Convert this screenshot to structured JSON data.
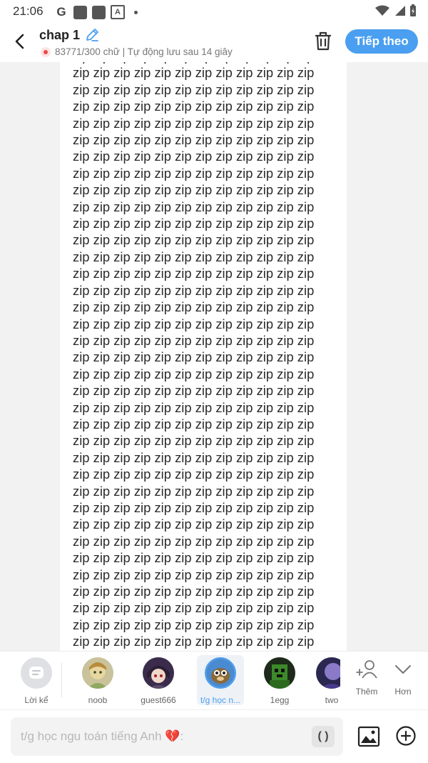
{
  "status_bar": {
    "time": "21:06",
    "google_letter": "G",
    "a_letter": "A"
  },
  "header": {
    "title": "chap 1",
    "subtitle": "83771/300 chữ | Tự động lưu sau 14 giây",
    "next_button": "Tiếp theo"
  },
  "editor": {
    "word": "zip",
    "words_per_line": 12,
    "visible_lines": 36
  },
  "characters": [
    {
      "label": "Lời kể",
      "icon": "narrator-icon"
    },
    {
      "label": "noob",
      "icon": "noob-avatar"
    },
    {
      "label": "guest666",
      "icon": "guest666-avatar"
    },
    {
      "label": "t/g học n...",
      "icon": "author-avatar",
      "active": true
    },
    {
      "label": "1egg",
      "icon": "1egg-avatar"
    },
    {
      "label": "two",
      "icon": "two-avatar"
    }
  ],
  "tools": {
    "add_label": "Thêm",
    "more_label": "Hơn"
  },
  "input": {
    "placeholder": "t/g học ngu toán tiếng Anh 💔:",
    "paren_button": "( )"
  },
  "colors": {
    "accent": "#4a9ff0",
    "background": "#f2f2f2"
  }
}
